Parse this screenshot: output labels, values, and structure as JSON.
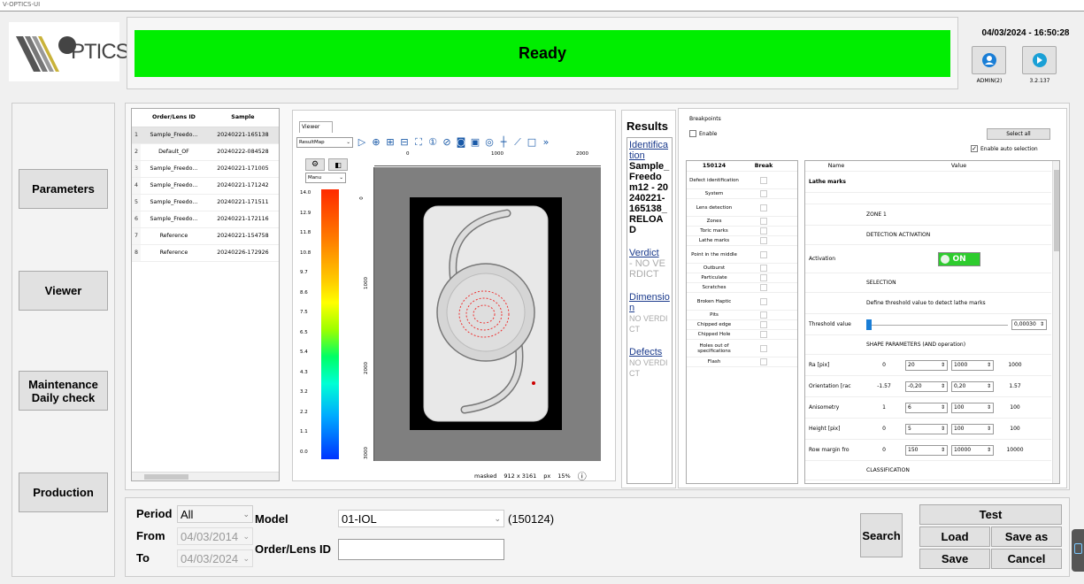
{
  "window": {
    "title": "V-OPTICS-UI"
  },
  "logo": {
    "text": "PTICS"
  },
  "status": {
    "text": "Ready",
    "color": "#00ee00"
  },
  "header": {
    "datetime": "04/03/2024 - 16:50:28",
    "user": "ADMIN(2)",
    "version": "3.2.137",
    "user_icon": "user-icon",
    "logout_icon": "logout-icon"
  },
  "nav": {
    "items": [
      {
        "label": "Parameters"
      },
      {
        "label": "Viewer"
      },
      {
        "label": "Maintenance Daily check"
      },
      {
        "label": "Production"
      }
    ]
  },
  "orders": {
    "headers": [
      "Order/Lens ID",
      "Sample"
    ],
    "rows": [
      {
        "n": "1",
        "id": "Sample_Freedo...",
        "sample": "20240221-165138"
      },
      {
        "n": "2",
        "id": "Default_OF",
        "sample": "20240222-084528"
      },
      {
        "n": "3",
        "id": "Sample_Freedo...",
        "sample": "20240221-171005"
      },
      {
        "n": "4",
        "id": "Sample_Freedo...",
        "sample": "20240221-171242"
      },
      {
        "n": "5",
        "id": "Sample_Freedo...",
        "sample": "20240221-171511"
      },
      {
        "n": "6",
        "id": "Sample_Freedo...",
        "sample": "20240221-172116"
      },
      {
        "n": "7",
        "id": "Reference",
        "sample": "20240221-154758"
      },
      {
        "n": "8",
        "id": "Reference",
        "sample": "20240226-172926"
      }
    ]
  },
  "viewer": {
    "tab": "Viewer",
    "map_select": "ResultMap",
    "mode_select": "Manu",
    "x_ticks": [
      "0",
      "1000",
      "2000"
    ],
    "y_ticks": [
      "0",
      "1000",
      "2000",
      "3000"
    ],
    "scale_ticks": [
      "14.0",
      "12.9",
      "11.8",
      "10.8",
      "9.7",
      "8.6",
      "7.5",
      "6.5",
      "5.4",
      "4.3",
      "3.2",
      "2.2",
      "1.1",
      "0.0"
    ],
    "footer": {
      "mask": "masked",
      "size": "912 x 3161",
      "unit": "px",
      "zoom": "15%"
    }
  },
  "results": {
    "title": "Results",
    "identification_label": "Identification",
    "identification_value": "Sample_Freedom12 - 20240221-165138_RELOAD",
    "verdict_label": "Verdict",
    "verdict_value": "- NO VERDICT",
    "dimension_label": "Dimension",
    "dimension_value": "NO VERDICT",
    "defects_label": "Defects",
    "defects_value": "NO VERDICT"
  },
  "breakpoints": {
    "title": "Breakpoints",
    "enable_label": "Enable",
    "select_all": "Select all",
    "auto_select_label": "Enable auto selection",
    "col_model": "150124",
    "col_break": "Break",
    "items": [
      "Defect identification",
      "System",
      "Lens detection",
      "Zones",
      "Toric marks",
      "Lathe marks",
      "Point in the middle",
      "Outburst",
      "Particulate",
      "Scratches",
      "Broken Haptic",
      "Pits",
      "Chipped edge",
      "Chipped Hole",
      "Holes out of specifications",
      "Flash"
    ]
  },
  "params": {
    "col_name": "Name",
    "col_value": "Value",
    "section": "Lathe marks",
    "zone": "ZONE 1",
    "detection_activation": "DETECTION ACTIVATION",
    "activation_label": "Activation",
    "activation_value": "ON",
    "selection": "SELECTION",
    "threshold_hint": "Define threshold value to detect lathe marks",
    "threshold_label": "Threshold value",
    "threshold_value": "0,00030",
    "threshold_fraction": 0.0,
    "shape_params": "SHAPE PARAMETERS (AND operation)",
    "ranges": [
      {
        "name": "Ra [pix]",
        "min": "0",
        "low": "20",
        "high": "1000",
        "max": "1000"
      },
      {
        "name": "Orientation [rac",
        "min": "-1.57",
        "low": "-0,20",
        "high": "0,20",
        "max": "1.57"
      },
      {
        "name": "Anisometry",
        "min": "1",
        "low": "6",
        "high": "100",
        "max": "100"
      },
      {
        "name": "Height [pix]",
        "min": "0",
        "low": "5",
        "high": "100",
        "max": "100"
      },
      {
        "name": "Row margin fro",
        "min": "0",
        "low": "150",
        "high": "10000",
        "max": "10000"
      }
    ],
    "classification": "CLASSIFICATION"
  },
  "search": {
    "period_label": "Period",
    "period_value": "All",
    "from_label": "From",
    "from_value": "04/03/2014",
    "to_label": "To",
    "to_value": "04/03/2024",
    "model_label": "Model",
    "model_value": "01-IOL",
    "model_code": "(150124)",
    "order_label": "Order/Lens ID",
    "order_value": "",
    "search_button": "Search"
  },
  "actions": {
    "test": "Test",
    "load": "Load",
    "save_as": "Save as",
    "save": "Save",
    "cancel": "Cancel"
  }
}
